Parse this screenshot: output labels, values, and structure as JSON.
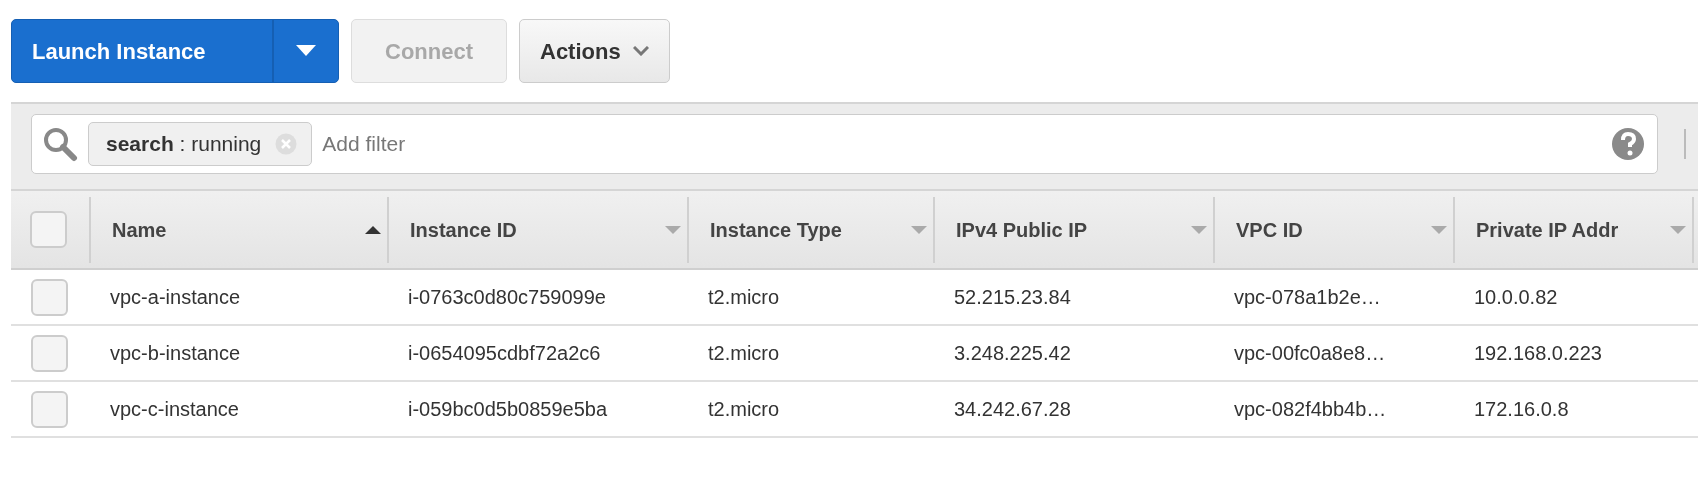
{
  "toolbar": {
    "buttons": [
      {
        "kind": "split",
        "label": "Launch Instance",
        "disabled": false
      },
      {
        "kind": "plain",
        "label": "Connect",
        "disabled": true
      },
      {
        "kind": "menu",
        "label": "Actions",
        "disabled": false
      }
    ]
  },
  "filter": {
    "chips": [
      {
        "text": "**search** : running"
      }
    ],
    "placeholder": "Add filter"
  },
  "table": {
    "select_all": {
      "checked": false
    },
    "columns": [
      {
        "label": "Name",
        "sorted": true
      },
      {
        "label": "Instance ID",
        "sorted": false
      },
      {
        "label": "Instance Type",
        "sorted": false
      },
      {
        "label": "IPv4 Public IP",
        "sorted": false
      },
      {
        "label": "VPC ID",
        "sorted": false
      },
      {
        "label": "Private IP Addr",
        "sorted": false
      }
    ],
    "rows": [
      {
        "checked": false,
        "cells": [
          "vpc-a-instance",
          "i-0763c0d80c759099e",
          "t2.micro",
          "52.215.23.84",
          "vpc-078a1b2e…",
          "10.0.0.82"
        ]
      },
      {
        "checked": false,
        "cells": [
          "vpc-b-instance",
          "i-0654095cdbf72a2c6",
          "t2.micro",
          "3.248.225.42",
          "vpc-00fc0a8e8…",
          "192.168.0.223"
        ]
      },
      {
        "checked": false,
        "cells": [
          "vpc-c-instance",
          "i-059bc0d5b0859e5ba",
          "t2.micro",
          "34.242.67.28",
          "vpc-082f4bb4b…",
          "172.16.0.8"
        ]
      }
    ]
  }
}
